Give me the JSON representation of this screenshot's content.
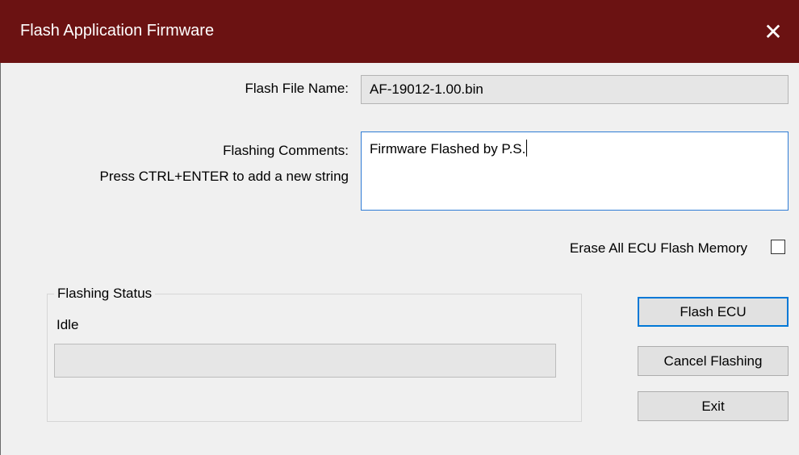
{
  "window": {
    "title": "Flash Application Firmware",
    "close_symbol": "✕"
  },
  "form": {
    "file_name_label": "Flash File Name:",
    "file_name_value": "AF-19012-1.00.bin",
    "comments_label": "Flashing Comments:",
    "comments_hint": "Press CTRL+ENTER to add a new string",
    "comments_value": "Firmware Flashed by P.S.",
    "erase_label": "Erase All ECU Flash Memory",
    "erase_checked": false
  },
  "status_group": {
    "legend": "Flashing Status",
    "status_text": "Idle",
    "progress_percent": 0
  },
  "buttons": {
    "flash": "Flash ECU",
    "cancel": "Cancel Flashing",
    "exit": "Exit"
  },
  "colors": {
    "titlebar": "#6b1212",
    "focus_accent": "#0078d7"
  }
}
